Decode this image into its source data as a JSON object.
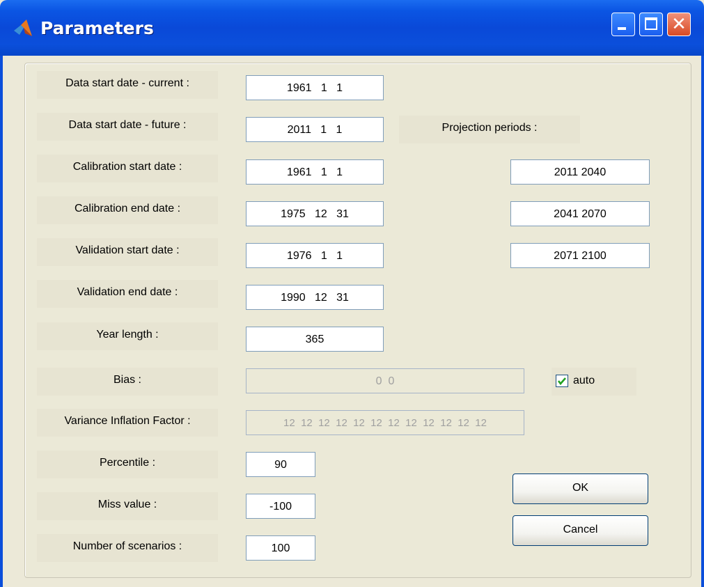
{
  "window": {
    "title": "Parameters",
    "controls": {
      "minimize_icon": "minimize-icon",
      "maximize_icon": "maximize-icon",
      "close_icon": "close-icon",
      "close_glyph": "✕"
    }
  },
  "fields": [
    {
      "label": "Data start date - current :",
      "value": "1961   1   1"
    },
    {
      "label": "Data start date - future :",
      "value": "2011   1   1"
    },
    {
      "label": "Calibration start date :",
      "value": "1961   1   1"
    },
    {
      "label": "Calibration end date :",
      "value": "1975   12   31"
    },
    {
      "label": "Validation start date :",
      "value": "1976   1   1"
    },
    {
      "label": "Validation end date :",
      "value": "1990   12   31"
    },
    {
      "label": "Year length :",
      "value": "365"
    },
    {
      "label": "Bias :",
      "value": "0  0"
    },
    {
      "label": "Variance Inflation Factor :",
      "value": "12  12  12  12  12  12  12  12  12  12  12  12"
    },
    {
      "label": "Percentile :",
      "value": "90"
    },
    {
      "label": "Miss value :",
      "value": "-100"
    },
    {
      "label": "Number of scenarios :",
      "value": "100"
    }
  ],
  "projection": {
    "label": "Projection periods :",
    "periods": [
      "2011 2040",
      "2041 2070",
      "2071 2100"
    ]
  },
  "auto_checkbox": {
    "label": "auto",
    "checked": true
  },
  "buttons": {
    "ok": "OK",
    "cancel": "Cancel"
  }
}
